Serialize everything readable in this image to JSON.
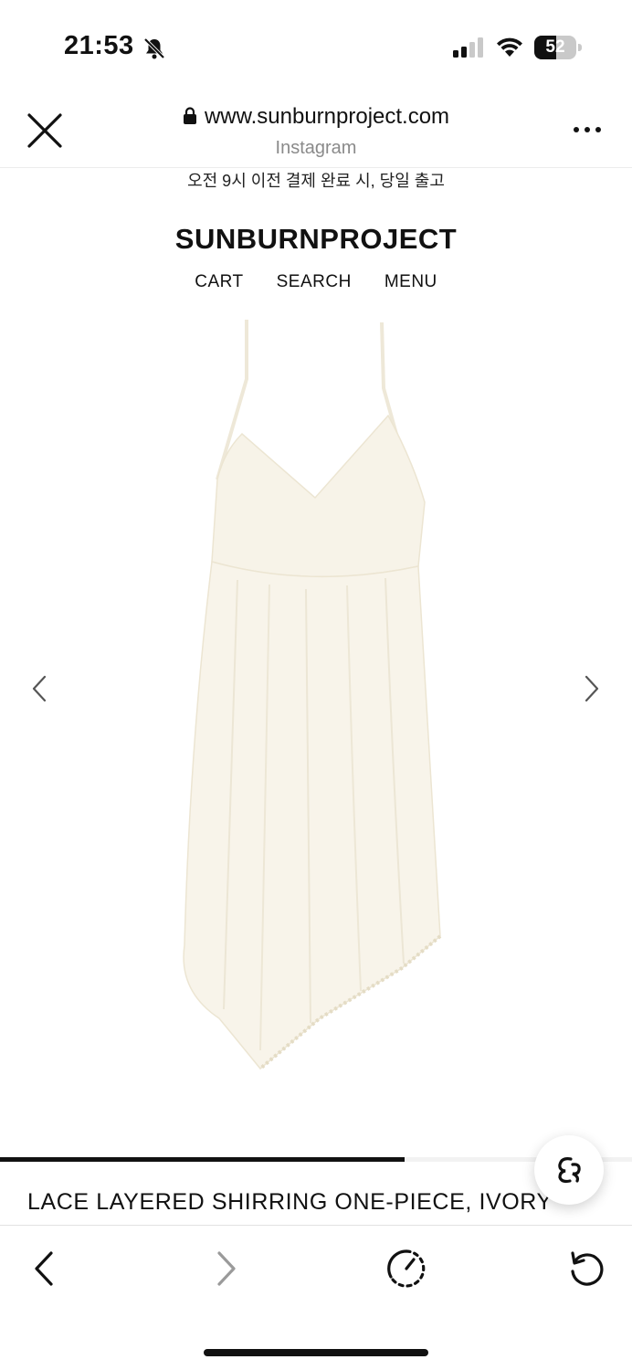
{
  "status_bar": {
    "time": "21:53",
    "battery_level": "52",
    "battery_fraction": 0.52
  },
  "browser": {
    "url": "www.sunburnproject.com",
    "source": "Instagram"
  },
  "site": {
    "notice": "오전 9시 이전 결제 완료 시, 당일 출고",
    "brand": "SUNBURNPROJECT",
    "nav": [
      "CART",
      "SEARCH",
      "MENU"
    ]
  },
  "product": {
    "title": "LACE LAYERED SHIRRING ONE-PIECE, IVORY",
    "image_color": "#f7f3e8",
    "gallery_progress_fraction": 0.64
  },
  "icons": {
    "close": "close-icon",
    "more": "more-icon",
    "prev_image": "chevron-left-icon",
    "next_image": "chevron-right-icon",
    "back": "back-icon",
    "forward": "forward-icon",
    "timer": "timer-icon",
    "reload": "reload-icon",
    "fab": "brand-chat-icon"
  },
  "colors": {
    "text": "#111111",
    "muted": "#8a8a8a",
    "disabled": "#9a9a9a"
  }
}
